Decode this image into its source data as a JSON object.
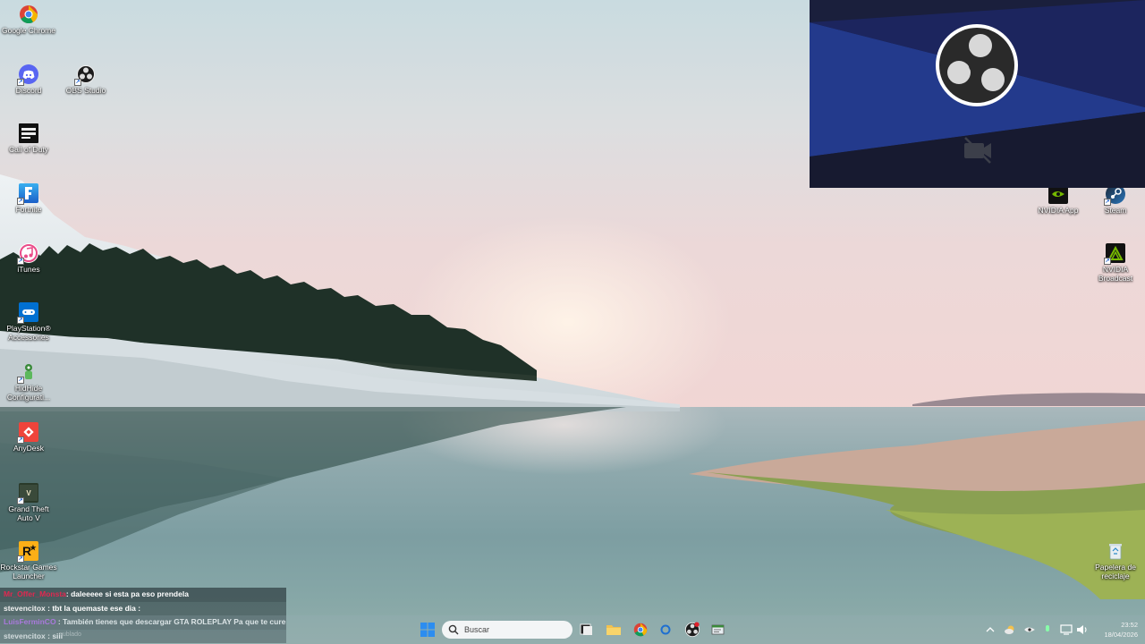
{
  "desktop_icons_left": [
    {
      "label": "Google Chrome",
      "icon": "chrome-icon"
    },
    {
      "label": "Discord",
      "icon": "discord-icon"
    },
    {
      "label": "OBS Studio",
      "icon": "obs-icon"
    },
    {
      "label": "Call of Duty",
      "icon": "call-of-duty-icon"
    },
    {
      "label": "Fortnite",
      "icon": "fortnite-icon"
    },
    {
      "label": "iTunes",
      "icon": "itunes-icon"
    },
    {
      "label": "PlayStation® Accessories",
      "icon": "playstation-icon"
    },
    {
      "label": "HidHide Configurati...",
      "icon": "hidhide-icon"
    },
    {
      "label": "AnyDesk",
      "icon": "anydesk-icon"
    },
    {
      "label": "Grand Theft Auto V",
      "icon": "gta-icon"
    },
    {
      "label": "Rockstar Games Launcher",
      "icon": "rockstar-icon"
    }
  ],
  "desktop_icons_right": [
    {
      "label": "NVIDIA App",
      "icon": "nvidia-icon"
    },
    {
      "label": "Steam",
      "icon": "steam-icon"
    },
    {
      "label": "NVIDIA Broadcast",
      "icon": "nvidia-broadcast-icon"
    },
    {
      "label": "Papelera de reciclaje",
      "icon": "recycle-bin-icon"
    }
  ],
  "obs_preview": {
    "logo": "obs-logo-icon",
    "status_icon": "camera-off-icon"
  },
  "chat": [
    {
      "user": "Mr_Offer_Monsta",
      "message": ": daleeeee si esta pa eso prendela",
      "color": "#e02850"
    },
    {
      "user": "stevencitox",
      "message": " : tbt la quemaste ese dia :",
      "color": "#f2f2f2"
    },
    {
      "user": "LuisFerminCO",
      "message": " : También tienes que descargar GTA ROLEPLAY Pa que te cures",
      "color": "#b45cf0"
    },
    {
      "user": "stevencitox",
      "message": " : siii",
      "color": "#f2f2f2"
    }
  ],
  "chat_subtext": "nublado",
  "taskbar": {
    "search_placeholder": "Buscar",
    "clock_time": "23:52",
    "clock_date": "18/04/2026"
  }
}
